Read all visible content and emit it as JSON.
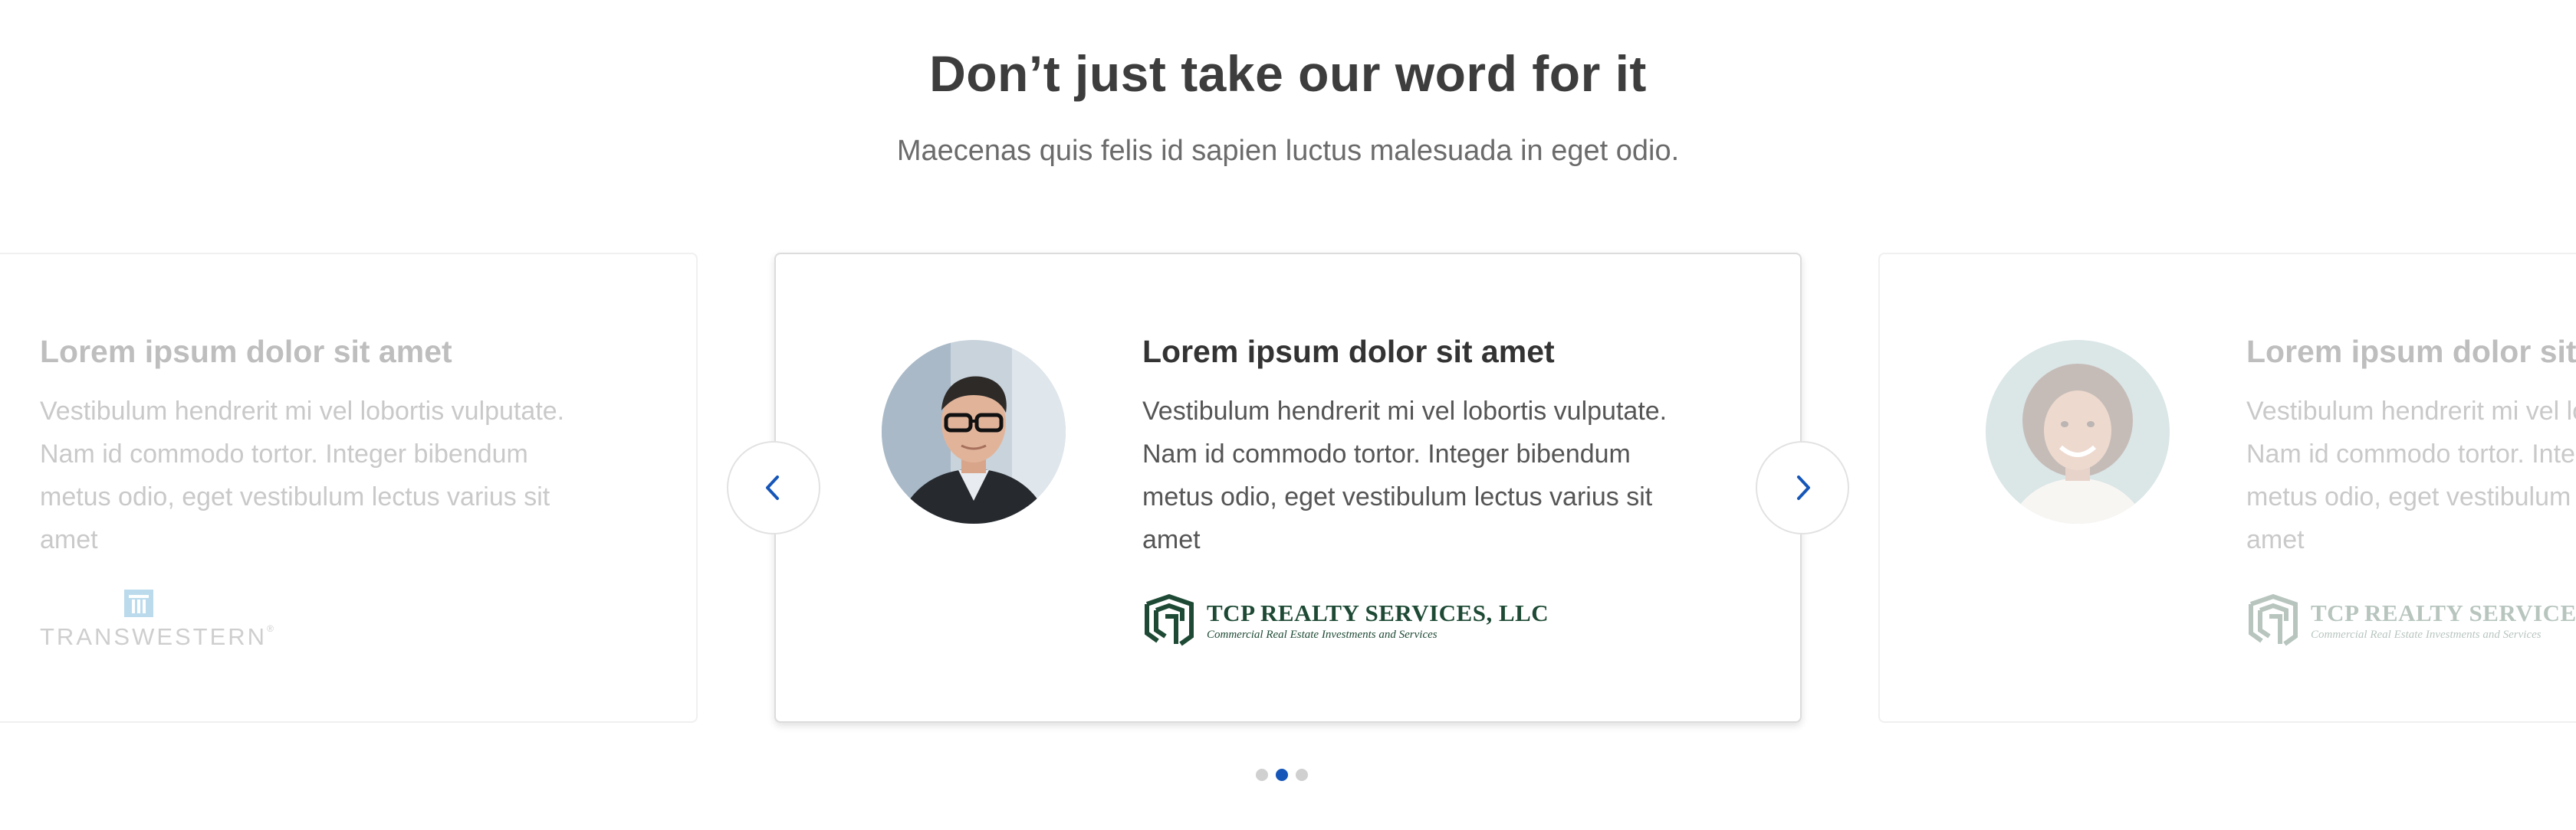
{
  "section": {
    "title": "Don’t just take our word for it",
    "subtitle": "Maecenas quis felis id sapien luctus malesuada in eget odio."
  },
  "colors": {
    "accent": "#1656b8",
    "title_text": "#3d3d3d",
    "body_text": "#555555",
    "tcp_green": "#1e4a35",
    "dot_inactive": "#d0d0d0"
  },
  "testimonials": [
    {
      "title": "Lorem ipsum dolor sit amet",
      "body": "Vestibulum hendrerit mi vel lobortis vulputate. Nam id commodo tortor. Integer bibendum metus odio, eget vestibulum lectus varius sit amet",
      "logo": {
        "icon": "transwestern-logo",
        "name": "TRANSWESTERN",
        "mark": "®"
      }
    },
    {
      "title": "Lorem ipsum dolor sit amet",
      "body": "Vestibulum hendrerit mi vel lobortis vulputate. Nam id commodo tortor. Integer bibendum metus odio, eget vestibulum lectus varius sit amet",
      "avatar": "man-with-glasses-portrait",
      "logo": {
        "icon": "tcp-realty-logo",
        "name": "TCP REALTY SERVICES, LLC",
        "tagline": "Commercial Real Estate Investments and Services"
      }
    },
    {
      "title": "Lorem ipsum dolor sit amet",
      "body": "Vestibulum hendrerit mi vel lobortis vulputate. Nam id commodo tortor. Integer bibendum metus odio, eget vestibulum lectus varius sit amet",
      "avatar": "smiling-woman-portrait",
      "logo": {
        "icon": "tcp-realty-logo",
        "name": "TCP REALTY SERVICES, LLC",
        "tagline": "Commercial Real Estate Investments and Services"
      }
    }
  ],
  "carousel": {
    "prev_icon": "chevron-left-icon",
    "next_icon": "chevron-right-icon",
    "slide_count": 3,
    "active_index": 1
  }
}
